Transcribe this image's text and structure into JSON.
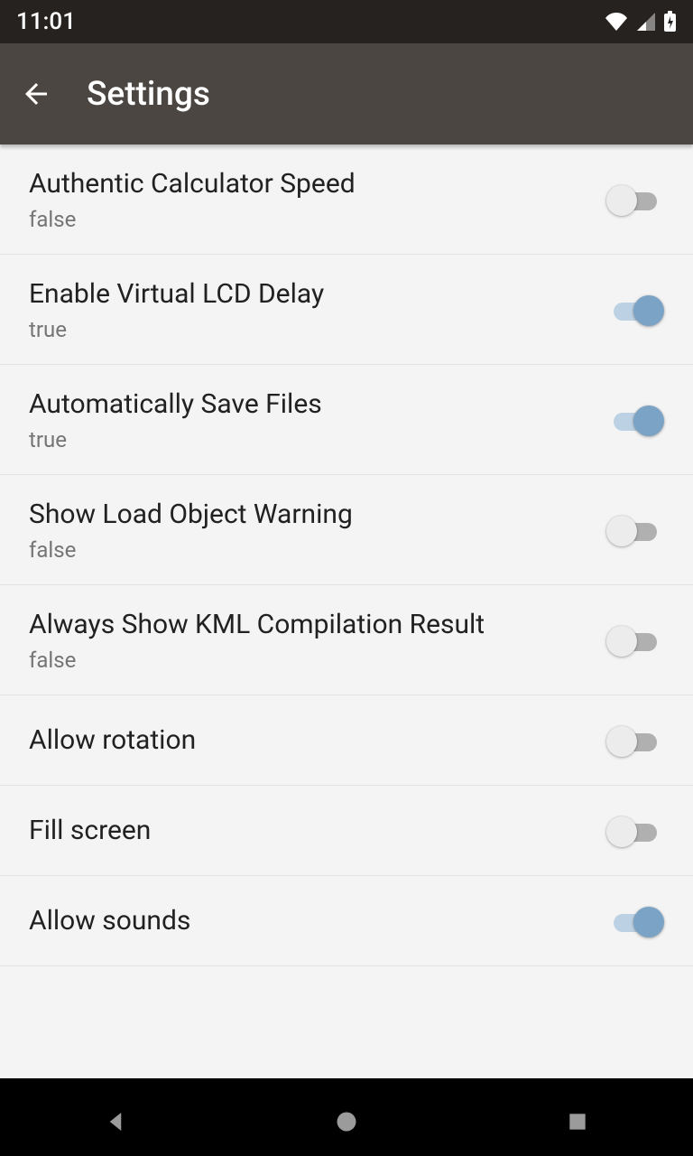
{
  "status": {
    "time": "11:01"
  },
  "header": {
    "title": "Settings"
  },
  "settings": [
    {
      "title": "Authentic Calculator Speed",
      "sub": "false",
      "on": false,
      "name": "setting-authentic-calculator-speed"
    },
    {
      "title": "Enable Virtual LCD Delay",
      "sub": "true",
      "on": true,
      "name": "setting-enable-virtual-lcd-delay"
    },
    {
      "title": "Automatically Save Files",
      "sub": "true",
      "on": true,
      "name": "setting-automatically-save-files"
    },
    {
      "title": "Show Load Object Warning",
      "sub": "false",
      "on": false,
      "name": "setting-show-load-object-warning"
    },
    {
      "title": "Always Show KML Compilation Result",
      "sub": "false",
      "on": false,
      "name": "setting-always-show-kml-compilation-result"
    },
    {
      "title": "Allow rotation",
      "sub": null,
      "on": false,
      "name": "setting-allow-rotation"
    },
    {
      "title": "Fill screen",
      "sub": null,
      "on": false,
      "name": "setting-fill-screen"
    },
    {
      "title": "Allow sounds",
      "sub": null,
      "on": true,
      "name": "setting-allow-sounds"
    }
  ]
}
